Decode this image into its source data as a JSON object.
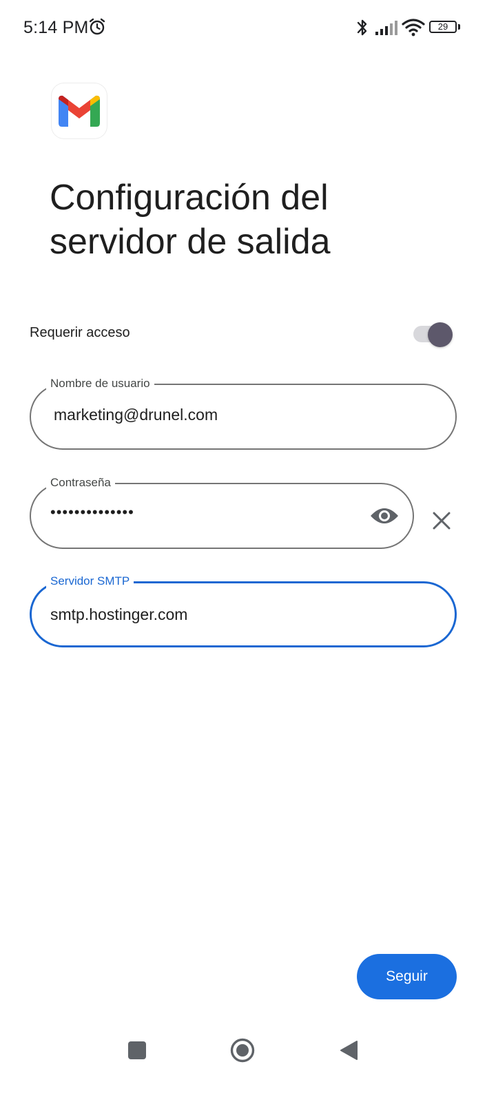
{
  "status_bar": {
    "time": "5:14 PM",
    "battery_level": "29",
    "icons": [
      "alarm-icon",
      "bluetooth-icon",
      "signal-icon",
      "wifi-icon",
      "battery-icon"
    ]
  },
  "app": {
    "logo": "gmail-logo"
  },
  "header": {
    "title": "Configuración del servidor de salida"
  },
  "require_login": {
    "label": "Requerir acceso",
    "enabled": true
  },
  "fields": {
    "username": {
      "label": "Nombre de usuario",
      "value": "marketing@drunel.com"
    },
    "password": {
      "label": "Contraseña",
      "masked_value": "••••••••••••••",
      "icons": [
        "eye-icon",
        "close-icon"
      ]
    },
    "smtp_server": {
      "label": "Servidor SMTP",
      "value": "smtp.hostinger.com",
      "focused": true
    }
  },
  "actions": {
    "next_label": "Seguir"
  },
  "navigation": {
    "icons": [
      "recents-icon",
      "home-icon",
      "back-icon"
    ]
  },
  "colors": {
    "accent": "#1a67d2",
    "button": "#1b6fe0",
    "toggle_thumb": "#5d586b",
    "gmail_red": "#ea4335",
    "gmail_blue": "#4285f4",
    "gmail_green": "#34a853",
    "gmail_yellow": "#fbbc04"
  }
}
